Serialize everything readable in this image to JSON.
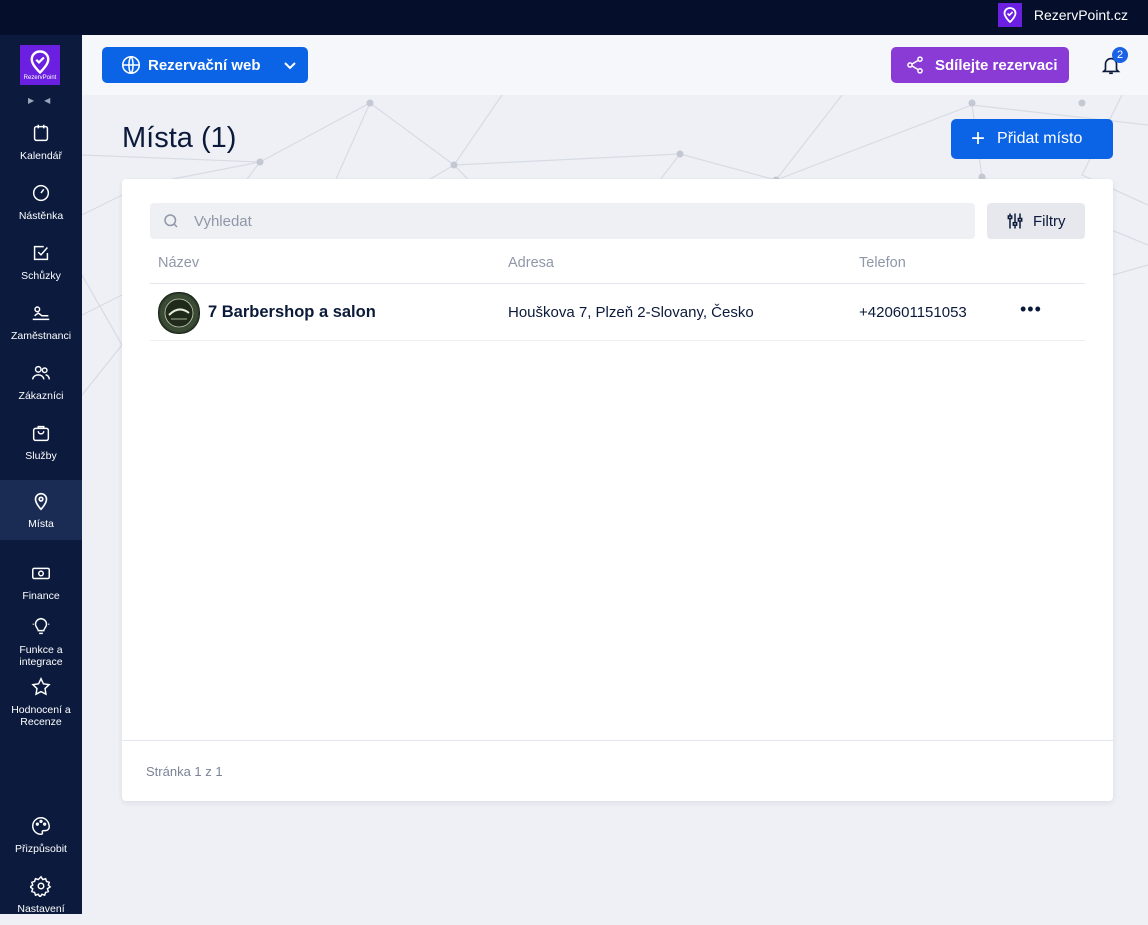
{
  "topbar": {
    "brand": "RezervPoint.cz"
  },
  "sidebar": {
    "logo_text": "RezervPoint",
    "items": [
      {
        "label": "Kalendář",
        "icon": "calendar-icon"
      },
      {
        "label": "Nástěnka",
        "icon": "gauge-icon"
      },
      {
        "label": "Schůzky",
        "icon": "checkbox-icon"
      },
      {
        "label": "Zaměstnanci",
        "icon": "employees-icon"
      },
      {
        "label": "Zákazníci",
        "icon": "customers-icon"
      },
      {
        "label": "Služby",
        "icon": "bag-icon"
      },
      {
        "label": "Místa",
        "icon": "map-pin-icon",
        "active": true
      },
      {
        "label": "Finance",
        "icon": "money-icon"
      },
      {
        "label": "Funkce a integrace",
        "icon": "lightbulb-icon"
      },
      {
        "label": "Hodnocení a Recenze",
        "icon": "star-icon"
      },
      {
        "label": "Přizpůsobit",
        "icon": "palette-icon"
      },
      {
        "label": "Nastavení",
        "icon": "gear-icon"
      }
    ]
  },
  "header": {
    "web_select": "Rezervační web",
    "share_label": "Sdílejte rezervaci",
    "notifications": "2"
  },
  "page": {
    "title": "Místa (1)",
    "add_label": "Přidat místo"
  },
  "table": {
    "search_placeholder": "Vyhledat",
    "filter_label": "Filtry",
    "columns": [
      "Název",
      "Adresa",
      "Telefon"
    ],
    "rows": [
      {
        "name": "7 Barbershop a salon",
        "address": "Houškova 7, Plzeň 2-Slovany, Česko",
        "phone": "+420601151053"
      }
    ],
    "pagination": "Stránka 1 z 1"
  },
  "colors": {
    "primary": "#0b63e5",
    "share": "#8a3bd6",
    "sidebar": "#0b1a3d",
    "brand": "#6b1fe0"
  }
}
